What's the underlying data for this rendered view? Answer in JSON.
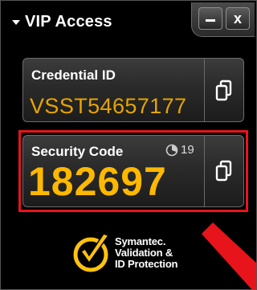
{
  "window": {
    "title": "VIP Access",
    "minimize_label": "–",
    "close_label": "x"
  },
  "credential": {
    "label": "Credential ID",
    "value": "VSST54657177"
  },
  "security": {
    "label": "Security Code",
    "value": "182697",
    "seconds_remaining": "19"
  },
  "logo": {
    "line1": "Symantec.",
    "line2": "Validation &",
    "line3": "ID Protection"
  },
  "colors": {
    "background": "#000000",
    "credential_text": "#e6a400",
    "security_code_text": "#ffb800",
    "highlight": "#e8141b",
    "logo_check": "#ffc20e"
  },
  "icons": [
    "collapse-arrow-icon",
    "minimize-icon",
    "close-icon",
    "copy-icon",
    "timer-icon",
    "symantec-check-icon"
  ]
}
